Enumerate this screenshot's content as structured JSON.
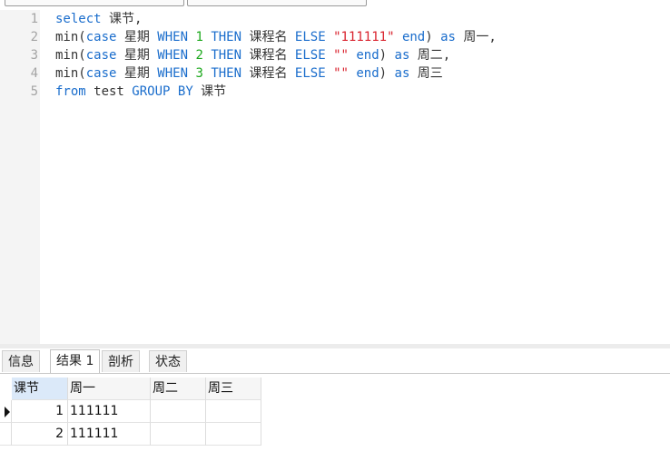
{
  "editor": {
    "lines": [
      {
        "num": "1",
        "tokens": [
          {
            "t": "select",
            "c": "kw"
          },
          {
            "t": " 课节,",
            "c": ""
          }
        ]
      },
      {
        "num": "2",
        "tokens": [
          {
            "t": "min(",
            "c": ""
          },
          {
            "t": "case",
            "c": "kw"
          },
          {
            "t": " 星期 ",
            "c": ""
          },
          {
            "t": "WHEN",
            "c": "kw"
          },
          {
            "t": " ",
            "c": ""
          },
          {
            "t": "1",
            "c": "num"
          },
          {
            "t": " ",
            "c": ""
          },
          {
            "t": "THEN",
            "c": "kw"
          },
          {
            "t": " 课程名 ",
            "c": ""
          },
          {
            "t": "ELSE",
            "c": "kw"
          },
          {
            "t": " ",
            "c": ""
          },
          {
            "t": "\"111111\"",
            "c": "str"
          },
          {
            "t": " ",
            "c": ""
          },
          {
            "t": "end",
            "c": "kw"
          },
          {
            "t": ") ",
            "c": ""
          },
          {
            "t": "as",
            "c": "kw"
          },
          {
            "t": " 周一,",
            "c": ""
          }
        ]
      },
      {
        "num": "3",
        "tokens": [
          {
            "t": "min(",
            "c": ""
          },
          {
            "t": "case",
            "c": "kw"
          },
          {
            "t": " 星期 ",
            "c": ""
          },
          {
            "t": "WHEN",
            "c": "kw"
          },
          {
            "t": " ",
            "c": ""
          },
          {
            "t": "2",
            "c": "num"
          },
          {
            "t": " ",
            "c": ""
          },
          {
            "t": "THEN",
            "c": "kw"
          },
          {
            "t": " 课程名 ",
            "c": ""
          },
          {
            "t": "ELSE",
            "c": "kw"
          },
          {
            "t": " ",
            "c": ""
          },
          {
            "t": "\"\"",
            "c": "str"
          },
          {
            "t": " ",
            "c": ""
          },
          {
            "t": "end",
            "c": "kw"
          },
          {
            "t": ") ",
            "c": ""
          },
          {
            "t": "as",
            "c": "kw"
          },
          {
            "t": " 周二,",
            "c": ""
          }
        ]
      },
      {
        "num": "4",
        "tokens": [
          {
            "t": "min(",
            "c": ""
          },
          {
            "t": "case",
            "c": "kw"
          },
          {
            "t": " 星期 ",
            "c": ""
          },
          {
            "t": "WHEN",
            "c": "kw"
          },
          {
            "t": " ",
            "c": ""
          },
          {
            "t": "3",
            "c": "num"
          },
          {
            "t": " ",
            "c": ""
          },
          {
            "t": "THEN",
            "c": "kw"
          },
          {
            "t": " 课程名 ",
            "c": ""
          },
          {
            "t": "ELSE",
            "c": "kw"
          },
          {
            "t": " ",
            "c": ""
          },
          {
            "t": "\"\"",
            "c": "str"
          },
          {
            "t": " ",
            "c": ""
          },
          {
            "t": "end",
            "c": "kw"
          },
          {
            "t": ") ",
            "c": ""
          },
          {
            "t": "as",
            "c": "kw"
          },
          {
            "t": " 周三",
            "c": ""
          }
        ]
      },
      {
        "num": "5",
        "tokens": [
          {
            "t": "from",
            "c": "kw"
          },
          {
            "t": " test ",
            "c": ""
          },
          {
            "t": "GROUP",
            "c": "kw"
          },
          {
            "t": " ",
            "c": ""
          },
          {
            "t": "BY",
            "c": "kw"
          },
          {
            "t": " 课节",
            "c": ""
          }
        ]
      }
    ]
  },
  "tabs": {
    "info": "信息",
    "result1": "结果 1",
    "profile": "剖析",
    "status": "状态"
  },
  "grid": {
    "headers": [
      "课节",
      "周一",
      "周二",
      "周三"
    ],
    "rows": [
      [
        "1",
        "111111",
        "",
        ""
      ],
      [
        "2",
        "111111",
        "",
        ""
      ]
    ]
  },
  "colors": {
    "keyword": "#1a6dcc",
    "number": "#1ca81c",
    "string": "#d9232e",
    "text": "#333333"
  }
}
